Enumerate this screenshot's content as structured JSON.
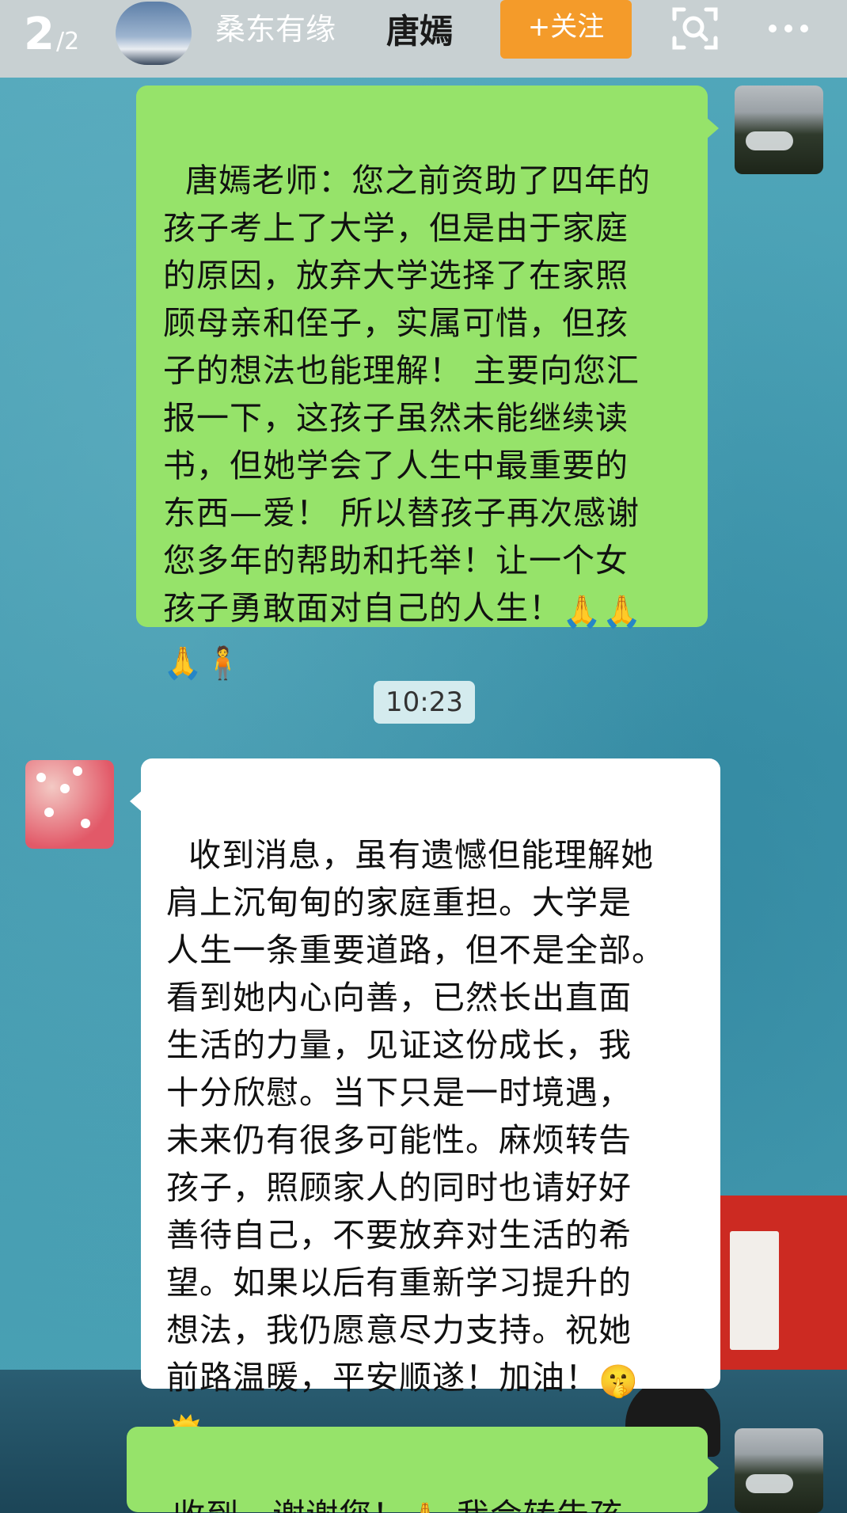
{
  "header": {
    "page_current": "2",
    "page_total": "/2",
    "author_name": "桑东有缘",
    "title": "唐嫣",
    "follow_label": "+关注",
    "icons": {
      "scan": "scan-icon",
      "more": "more-icon"
    }
  },
  "messages": [
    {
      "side": "right",
      "text": "唐嫣老师：您之前资助了四年的\n孩子考上了大学，但是由于家庭\n的原因，放弃大学选择了在家照\n顾母亲和侄子，实属可惜，但孩\n子的想法也能理解！ 主要向您汇\n报一下，这孩子虽然未能继续读\n书，但她学会了人生中最重要的\n东西—爱！ 所以替孩子再次感谢\n您多年的帮助和托举！让一个女\n孩子勇敢面对自己的人生！",
      "emoji_line1": "🙏🙏",
      "emoji_line2": "🙏🧍"
    },
    {
      "side": "left",
      "text": "收到消息，虽有遗憾但能理解她\n肩上沉甸甸的家庭重担。大学是\n人生一条重要道路，但不是全部。\n看到她内心向善，已然长出直面\n生活的力量，见证这份成长，我\n十分欣慰。当下只是一时境遇，\n未来仍有很多可能性。麻烦转告\n孩子，照顾家人的同时也请好好\n善待自己，不要放弃对生活的希\n望。如果以后有重新学习提升的\n想法，我仍愿意尽力支持。祝她\n前路温暖，平安顺遂！加油！",
      "emoji_line1": "🤫",
      "emoji_line2": "🌞"
    },
    {
      "side": "right",
      "text_before": "收到，谢谢您！",
      "emoji": "🙏",
      "text_after": " 我会转告孩子！"
    }
  ],
  "timestamp": "10:23",
  "colors": {
    "green_bubble": "#96e36a",
    "white_bubble": "#ffffff",
    "follow_button": "#f49b2a",
    "chat_background": "#4aa0b4"
  }
}
